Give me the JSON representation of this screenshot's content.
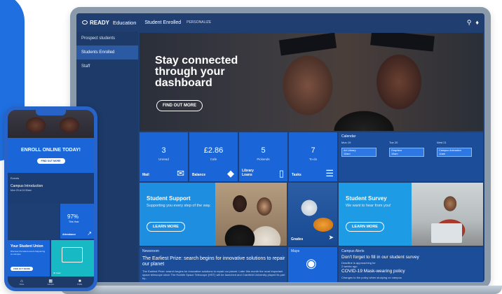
{
  "desktop": {
    "brand": {
      "name": "READY",
      "suffix": "Education"
    },
    "topnav": {
      "section": "Student Enrolled",
      "sub": "PERSONALIZE"
    },
    "sidebar": {
      "items": [
        {
          "label": "Prospect students"
        },
        {
          "label": "Students Enrolled",
          "active": true
        },
        {
          "label": "Staff"
        }
      ]
    },
    "hero": {
      "title": "Stay connected through your dashboard",
      "button": "FIND OUT MORE"
    },
    "tiles": {
      "mail": {
        "value": "3",
        "sub": "Unread",
        "label": "Mail",
        "icon": "envelope-icon"
      },
      "balance": {
        "value": "£2.86",
        "sub": "Cafe",
        "label": "Balance",
        "icon": "tag-icon"
      },
      "library": {
        "value": "5",
        "sub": "Pickends",
        "label": "Library Loans",
        "icon": "device-icon"
      },
      "tasks": {
        "value": "7",
        "sub": "To-do",
        "label": "Tasks",
        "icon": "clipboard-icon"
      }
    },
    "calendar": {
      "title": "Calendar",
      "days": [
        "Mon 19",
        "Tue 20",
        "Wed 21"
      ],
      "events": [
        {
          "title": "Art Library",
          "time": "10am"
        },
        {
          "title": "Graphics",
          "time": "10am"
        },
        {
          "title": "Campus Animation",
          "time": "11am"
        }
      ]
    },
    "support": {
      "title": "Student Support",
      "text": "Supporting you every step of the way.",
      "button": "LEARN MORE"
    },
    "grades": {
      "label": "Grades"
    },
    "survey": {
      "title": "Student Survey",
      "text": "We want to hear from you!",
      "button": "LEARN MORE"
    },
    "newsroom": {
      "title": "Newsroom",
      "headline": "The Earliest Prize: search begins for innovative solutions to repair our planet",
      "body": "The Earliest Prize: search begins for innovative solutions to repair our planet. Later this month the most important space telescope since The Hubble Space Telescope (HST) will be launched and Cranfield University played its part by..."
    },
    "maps": {
      "title": "Maps"
    },
    "alerts": {
      "title": "Campus Alerts",
      "items": [
        {
          "title": "Don't forget to fill in our student survey",
          "sub": "Deadline is approaching for",
          "time": "2 weeks ago"
        },
        {
          "title": "COVID-19 Mask-wearing policy",
          "sub": "Changes to the policy when studying on campus"
        }
      ]
    }
  },
  "phone": {
    "enroll": {
      "title": "ENROLL ONLINE TODAY!",
      "button": "FIND OUT MORE"
    },
    "events": {
      "title": "Events",
      "item": "Campus Introduction",
      "date": "Mon 29 at 10:30am"
    },
    "attendance": {
      "value": "97%",
      "sub": "This Year",
      "label": "Attendance"
    },
    "union": {
      "title": "Your Student Union",
      "text": "Discover the latest events happening on campus",
      "button": "FIND OUT MORE"
    },
    "card": {
      "label": "ID Card"
    },
    "tabs": [
      {
        "label": "Home",
        "icon": "home-icon"
      },
      {
        "label": "Campus",
        "icon": "building-icon"
      },
      {
        "label": "Profile",
        "icon": "profile-icon"
      }
    ]
  }
}
